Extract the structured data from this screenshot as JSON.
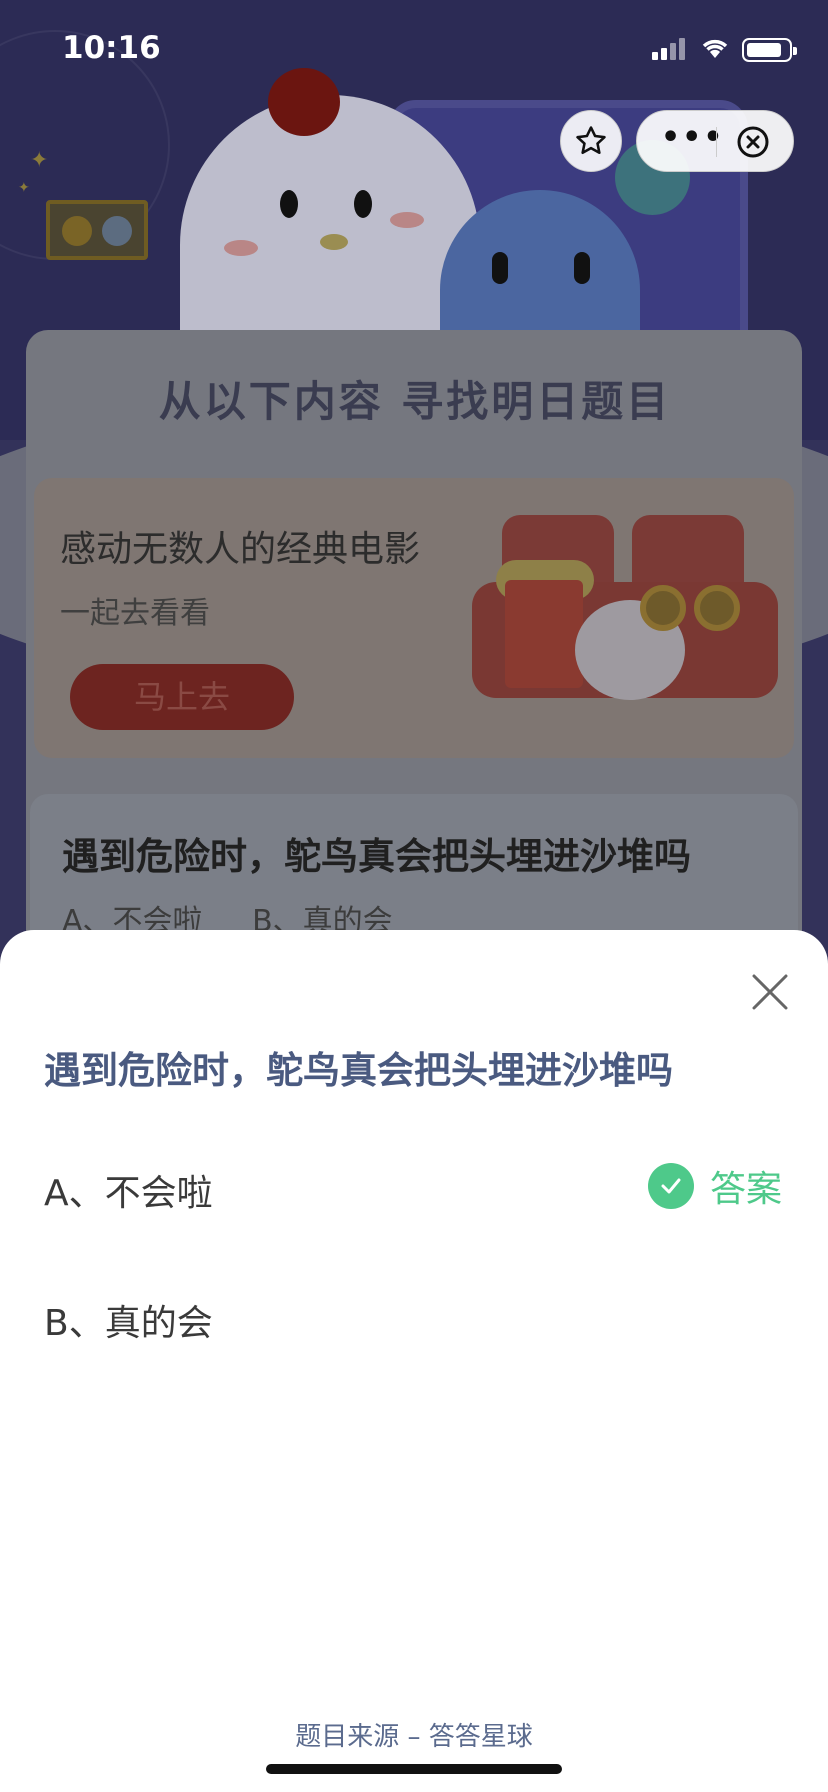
{
  "status_bar": {
    "time": "10:16"
  },
  "capsule": {
    "star_icon": "star-icon",
    "more_icon": "more-dots-icon",
    "close_icon": "close-circle-icon"
  },
  "background": {
    "section_title": "从以下内容 寻找明日题目",
    "movie_card": {
      "title": "感动无数人的经典电影",
      "subtitle": "一起去看看",
      "button": "马上去"
    },
    "question_card": {
      "question": "遇到危险时，鸵鸟真会把头埋进沙堆吗",
      "option_a": "A、不会啦",
      "option_b": "B、真的会"
    }
  },
  "sheet": {
    "question": "遇到危险时，鸵鸟真会把头埋进沙堆吗",
    "options": [
      {
        "label": "A、不会啦",
        "is_answer": true
      },
      {
        "label": "B、真的会",
        "is_answer": false
      }
    ],
    "answer_label": "答案",
    "source": "题目来源 – 答答星球"
  },
  "colors": {
    "answer_green": "#4ec98a",
    "question_blue": "#4a5a80"
  }
}
